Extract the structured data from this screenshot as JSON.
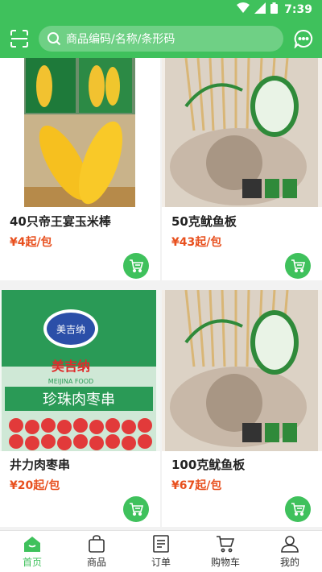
{
  "status_bar": {
    "time": "7:39"
  },
  "header": {
    "search_placeholder": "商品编码/名称/条形码"
  },
  "products": [
    {
      "title": "40只帝王宴玉米棒",
      "price": "¥4起/包"
    },
    {
      "title": "50克鱿鱼板",
      "price": "¥43起/包"
    },
    {
      "title": "井力肉枣串",
      "price": "¥20起/包"
    },
    {
      "title": "100克鱿鱼板",
      "price": "¥67起/包"
    }
  ],
  "product_images": {
    "meat_bag": {
      "brand": "美吉纳",
      "brand_en": "MEIJINA FOOD",
      "line": "珍珠肉枣串"
    }
  },
  "tabbar": [
    {
      "label": "首页"
    },
    {
      "label": "商品"
    },
    {
      "label": "订单"
    },
    {
      "label": "购物车"
    },
    {
      "label": "我的"
    }
  ],
  "colors": {
    "brand": "#3fc15c",
    "price": "#e8501e"
  }
}
